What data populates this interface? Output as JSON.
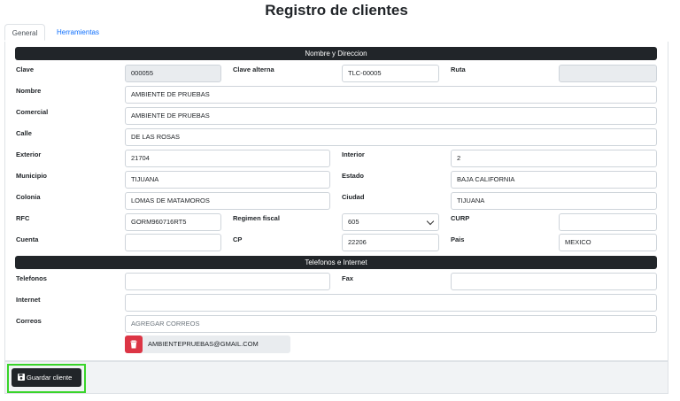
{
  "page": {
    "title": "Registro de clientes"
  },
  "tabs": [
    {
      "label": "General",
      "active": true
    },
    {
      "label": "Herramientas",
      "active": false
    }
  ],
  "sections": {
    "nombre": "Nombre y Direccion",
    "telefonos": "Telefonos e Internet"
  },
  "fields": {
    "clave": {
      "label": "Clave",
      "value": "000055"
    },
    "clave_alterna": {
      "label": "Clave alterna",
      "value": "TLC-00005"
    },
    "ruta": {
      "label": "Ruta",
      "value": ""
    },
    "nombre": {
      "label": "Nombre",
      "value": "AMBIENTE DE PRUEBAS"
    },
    "comercial": {
      "label": "Comercial",
      "value": "AMBIENTE DE PRUEBAS"
    },
    "calle": {
      "label": "Calle",
      "value": "DE LAS ROSAS"
    },
    "exterior": {
      "label": "Exterior",
      "value": "21704"
    },
    "interior": {
      "label": "Interior",
      "value": "2"
    },
    "municipio": {
      "label": "Municipio",
      "value": "TIJUANA"
    },
    "estado": {
      "label": "Estado",
      "value": "BAJA CALIFORNIA"
    },
    "colonia": {
      "label": "Colonia",
      "value": "LOMAS DE MATAMOROS"
    },
    "ciudad": {
      "label": "Ciudad",
      "value": "TIJUANA"
    },
    "rfc": {
      "label": "RFC",
      "value": "GORM960716RT5"
    },
    "regimen_fiscal": {
      "label": "Regimen fiscal",
      "value": "605"
    },
    "curp": {
      "label": "CURP",
      "value": ""
    },
    "cuenta": {
      "label": "Cuenta",
      "value": ""
    },
    "cp": {
      "label": "CP",
      "value": "22206"
    },
    "pais": {
      "label": "Pais",
      "value": "MEXICO"
    },
    "telefonos": {
      "label": "Telefonos",
      "value": ""
    },
    "fax": {
      "label": "Fax",
      "value": ""
    },
    "internet": {
      "label": "Internet",
      "value": ""
    },
    "correos": {
      "label": "Correos",
      "placeholder": "AGREGAR CORREOS"
    }
  },
  "emails": [
    "AMBIENTEPRUEBAS@GMAIL.COM"
  ],
  "footer": {
    "save_label": "Guardar cliente"
  },
  "icons": {
    "delete": "trash-icon",
    "save": "floppy-disk-icon",
    "select": "chevron-down-icon"
  },
  "colors": {
    "accent_dark": "#212529",
    "danger": "#dc3545",
    "link": "#0d6efd",
    "highlight": "#39d42a"
  }
}
